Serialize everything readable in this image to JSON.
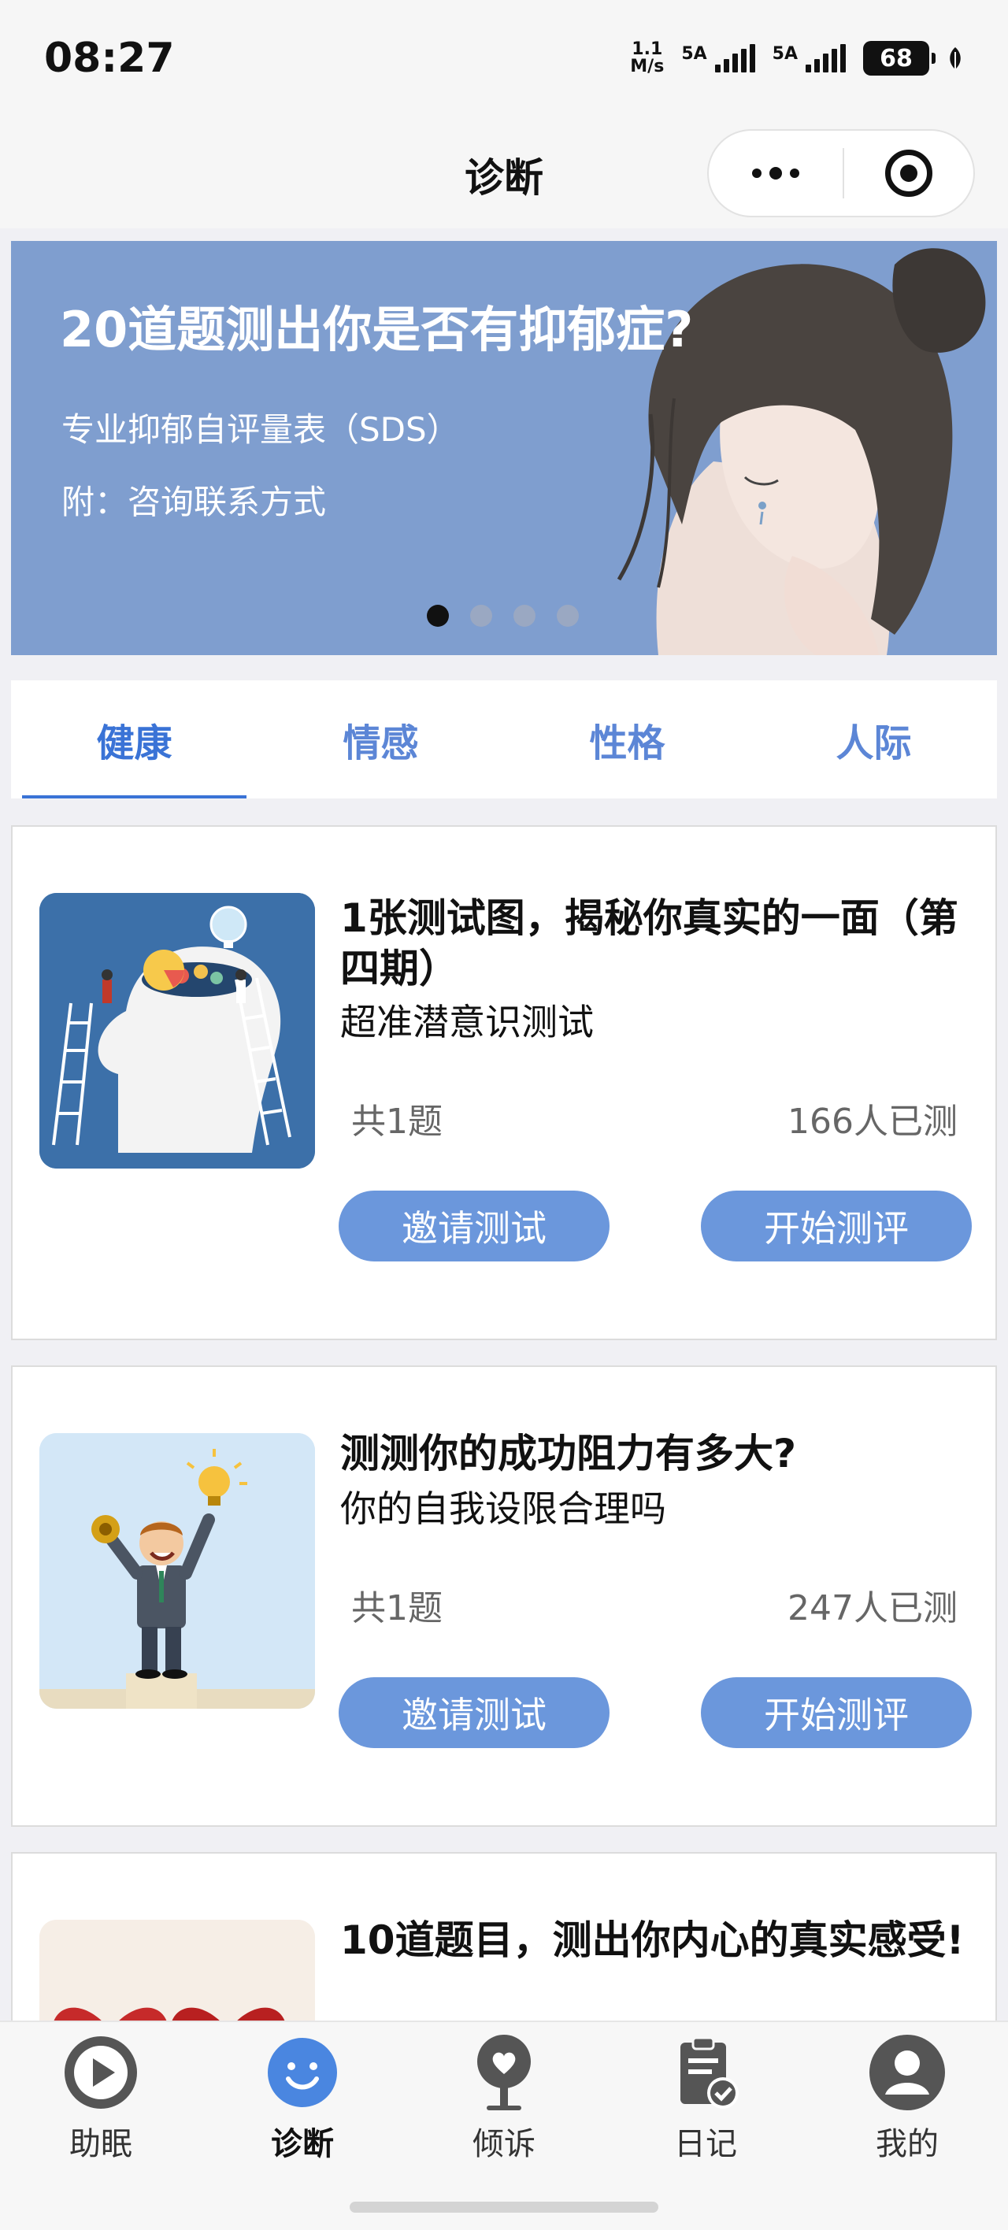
{
  "status_bar": {
    "time": "08:27",
    "speed_value": "1.1",
    "speed_unit": "M/s",
    "signal1_label": "5A",
    "signal2_label": "5A",
    "battery": "68"
  },
  "nav": {
    "title": "诊断",
    "more_icon": "more-dots-icon",
    "target_icon": "target-icon"
  },
  "banner": {
    "title": "20道题测出你是否有抑郁症?",
    "subtitle1": "专业抑郁自评量表（SDS）",
    "subtitle2": "附：咨询联系方式",
    "dots_count": 4,
    "active_dot": 1,
    "background_color": "#7f9ecf"
  },
  "tabs": [
    {
      "label": "健康",
      "active": true
    },
    {
      "label": "情感",
      "active": false
    },
    {
      "label": "性格",
      "active": false
    },
    {
      "label": "人际",
      "active": false
    }
  ],
  "cards": [
    {
      "title": "1张测试图，揭秘你真实的一面（第四期）",
      "subtitle": "超准潜意识测试",
      "count": "共1题",
      "done": "166人已测",
      "invite_label": "邀请测试",
      "start_label": "开始测评",
      "image_icon": "head-ladders-illustration"
    },
    {
      "title": "测测你的成功阻力有多大?",
      "subtitle": "你的自我设限合理吗",
      "count": "共1题",
      "done": "247人已测",
      "invite_label": "邀请测试",
      "start_label": "开始测评",
      "image_icon": "businessman-lightbulb-illustration"
    },
    {
      "title": "10道题目，测出你内心的真实感受!",
      "image_icon": "red-hearts-illustration"
    }
  ],
  "tabbar": [
    {
      "label": "助眠",
      "icon": "play-circle-icon",
      "active": false
    },
    {
      "label": "诊断",
      "icon": "smile-face-icon",
      "active": true
    },
    {
      "label": "倾诉",
      "icon": "heart-tree-icon",
      "active": false
    },
    {
      "label": "日记",
      "icon": "clipboard-check-icon",
      "active": false
    },
    {
      "label": "我的",
      "icon": "user-avatar-icon",
      "active": false
    }
  ],
  "colors": {
    "accent": "#3a73d6",
    "button": "#6b97dc",
    "tab_inactive": "#5c86d6"
  }
}
